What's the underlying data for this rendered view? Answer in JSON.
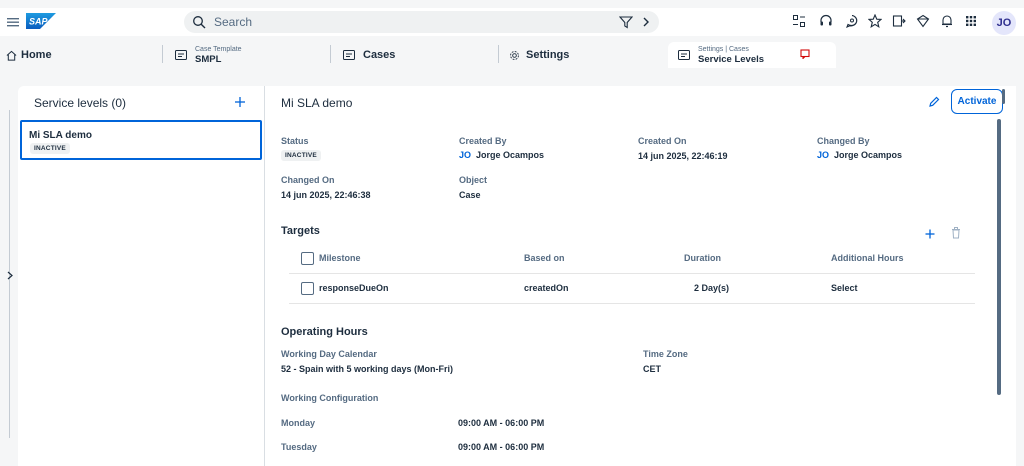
{
  "shell": {
    "search_placeholder": "Search",
    "avatar_initials": "JO",
    "icons": [
      "menu-icon",
      "search-icon",
      "filter-icon",
      "chevron-right-icon",
      "notes-icon",
      "headset-icon",
      "help-icon",
      "favorite-icon",
      "export-icon",
      "trophy-icon",
      "notification-icon",
      "apps-grid-icon"
    ]
  },
  "tabs": [
    {
      "label": "Home"
    },
    {
      "small": "Case Template",
      "label": "SMPL"
    },
    {
      "label": "Cases"
    },
    {
      "label": "Settings"
    },
    {
      "small": "Settings | Cases",
      "label": "Service Levels"
    }
  ],
  "left": {
    "title": "Service levels (0)",
    "items": [
      {
        "title": "Mi SLA demo",
        "status": "INACTIVE"
      }
    ]
  },
  "detail": {
    "title": "Mi SLA demo",
    "activate_label": "Activate",
    "fields": {
      "status_label": "Status",
      "status_value": "INACTIVE",
      "created_by_label": "Created By",
      "created_by_initials": "JO",
      "created_by_value": "Jorge Ocampos",
      "created_on_label": "Created On",
      "created_on_value": "14 jun 2025, 22:46:19",
      "changed_by_label": "Changed By",
      "changed_by_initials": "JO",
      "changed_by_value": "Jorge Ocampos",
      "changed_on_label": "Changed On",
      "changed_on_value": "14 jun 2025, 22:46:38",
      "object_label": "Object",
      "object_value": "Case"
    },
    "targets": {
      "title": "Targets",
      "columns": [
        "Milestone",
        "Based on",
        "Duration",
        "Additional Hours"
      ],
      "rows": [
        [
          "responseDueOn",
          "createdOn",
          "2 Day(s)",
          "Select"
        ]
      ]
    },
    "operating_hours": {
      "title": "Operating Hours",
      "calendar_label": "Working Day Calendar",
      "calendar_value": "52 - Spain with 5 working days (Mon-Fri)",
      "timezone_label": "Time Zone",
      "timezone_value": "CET",
      "config_label": "Working Configuration",
      "days": [
        {
          "day": "Monday",
          "hours": "09:00 AM - 06:00 PM"
        },
        {
          "day": "Tuesday",
          "hours": "09:00 AM - 06:00 PM"
        }
      ]
    }
  },
  "colors": {
    "accent": "#0064d9",
    "text": "#1d2d3e",
    "muted": "#556b82",
    "background": "#f5f6f7"
  }
}
